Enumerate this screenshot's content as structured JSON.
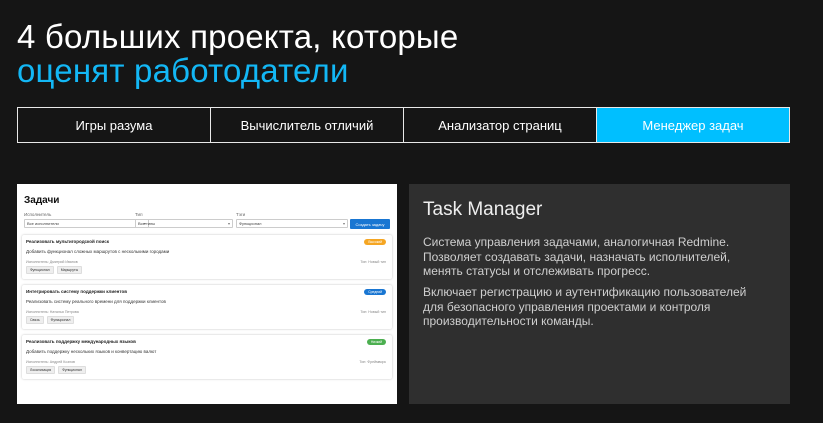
{
  "headline": {
    "line1": "4 больших проекта, которые",
    "line2": "оценят работодатели"
  },
  "colors": {
    "accent": "#00bfff",
    "headline_accent": "#13b7f5",
    "panel_bg": "#2f2f2f"
  },
  "tabs": [
    {
      "label": "Игры разума",
      "active": false
    },
    {
      "label": "Вычислитель отличий",
      "active": false
    },
    {
      "label": "Анализатор страниц",
      "active": false
    },
    {
      "label": "Менеджер задач",
      "active": true
    }
  ],
  "preview": {
    "title": "Задачи",
    "filters": [
      {
        "label": "Исполнитель",
        "value": "Все исполнители"
      },
      {
        "label": "Тип",
        "value": "Все типы"
      },
      {
        "label": "Тэги",
        "value": "Функционал"
      }
    ],
    "create_button": "Создать задачу",
    "tasks": [
      {
        "title": "Реализовать мультигородской поиск",
        "description": "Добавить функционал сложных маршрутов с несколькими городами",
        "assignee": "Исполнитель: Дмитрий Иванов",
        "type": "Тип: Новый тип",
        "badge": "Высокий",
        "badge_color": "#f5a623",
        "tags": [
          "Функционал",
          "Маршруты"
        ]
      },
      {
        "title": "Интегрировать систему поддержки клиентов",
        "description": "Реализовать систему реального времени для поддержки клиентов",
        "assignee": "Исполнитель: Наталья Петрова",
        "type": "Тип: Новый тип",
        "badge": "Средний",
        "badge_color": "#1976d2",
        "tags": [
          "Связь",
          "Функционал"
        ]
      },
      {
        "title": "Реализовать поддержку международных языков",
        "description": "Добавить поддержку нескольких языков и конвертацию валют",
        "assignee": "Исполнитель: Андрей Козлов",
        "type": "Тип: Фреймворк",
        "badge": "Низкий",
        "badge_color": "#4caf50",
        "tags": [
          "Локализация",
          "Функционал"
        ]
      }
    ]
  },
  "panel": {
    "title": "Task Manager",
    "paragraph1": "Система управления задачами, аналогичная Redmine. Позволяет создавать задачи, назначать исполнителей, менять статусы и отслеживать прогресс.",
    "paragraph2": "Включает регистрацию и аутентификацию пользователей для безопасного управления проектами и контроля производительности команды."
  }
}
